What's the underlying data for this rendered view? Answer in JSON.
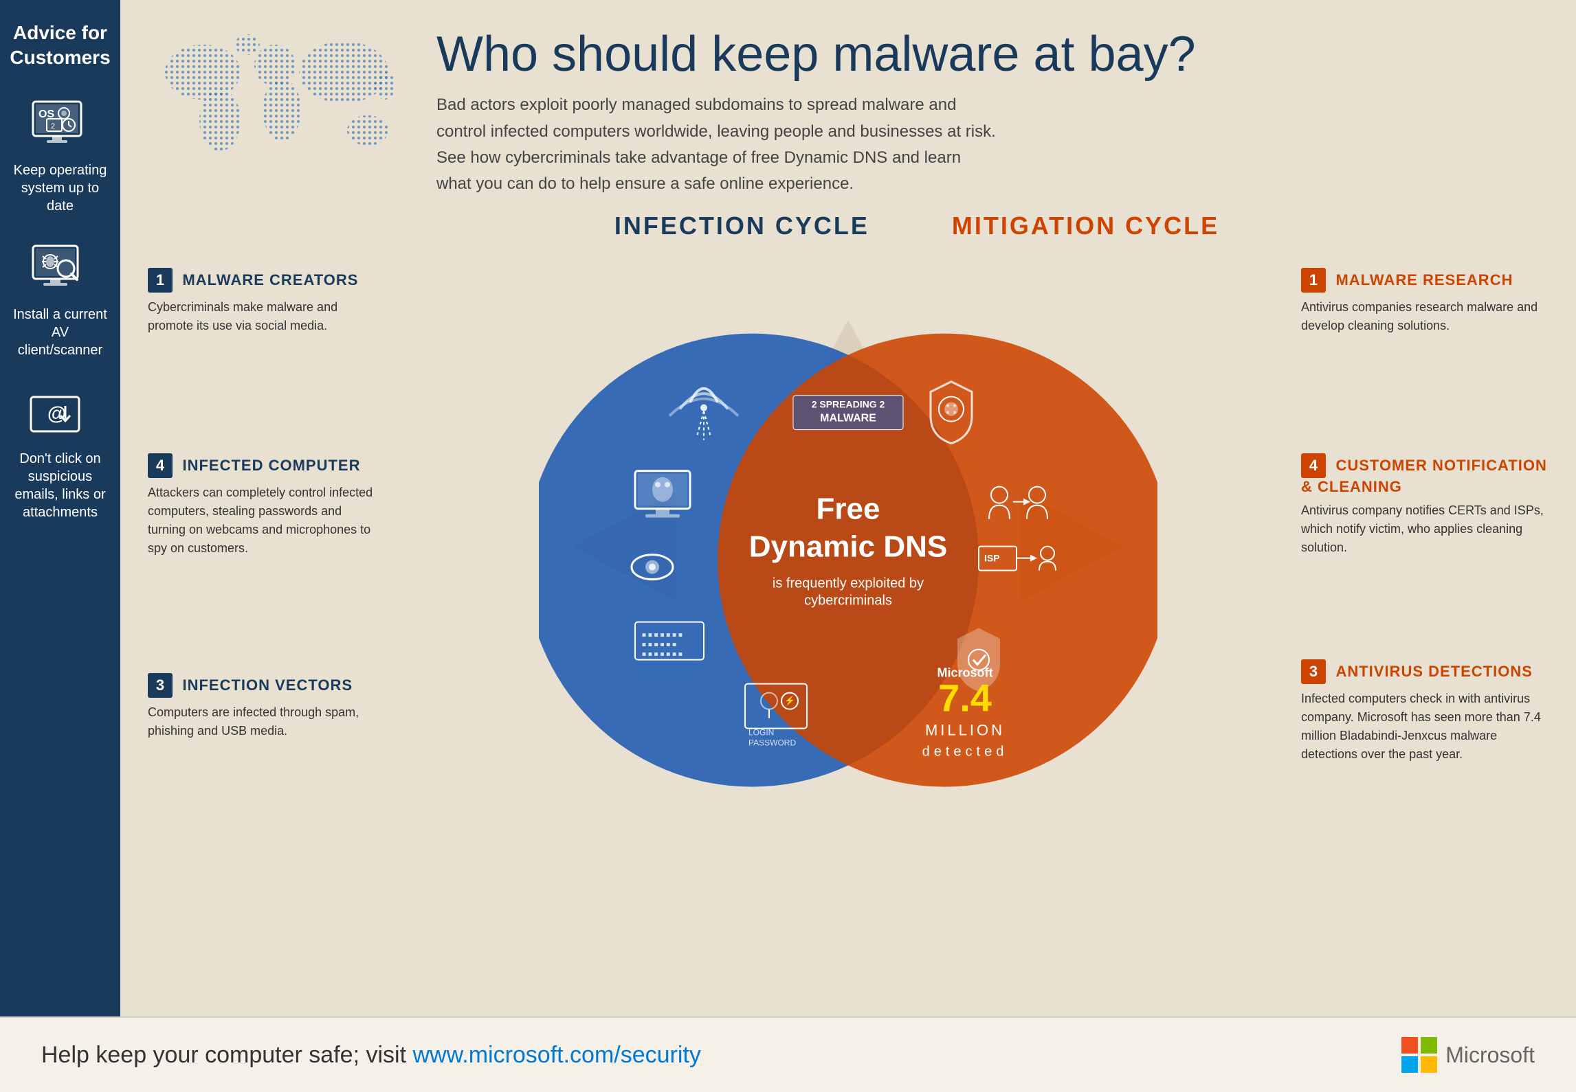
{
  "sidebar": {
    "title": "Advice for\nCustomers",
    "items": [
      {
        "label": "Keep operating\nsystem up to date",
        "icon": "os-icon"
      },
      {
        "label": "Install a current\nAV client/scanner",
        "icon": "av-icon"
      },
      {
        "label": "Don't click on\nsuspicious\nemails, links or\nattachments",
        "icon": "email-icon"
      }
    ]
  },
  "header": {
    "title": "Who should keep malware at bay?",
    "subtitle": "Bad actors exploit poorly managed subdomains to spread malware and control infected computers worldwide, leaving people and businesses at risk. See how cybercriminals take advantage of free Dynamic DNS and learn what you can do to help ensure a safe online experience."
  },
  "cycles": {
    "infection_label": "INFECTION CYCLE",
    "mitigation_label": "MITIGATION CYCLE"
  },
  "center": {
    "title": "Free\nDynamic DNS",
    "subtitle": "is frequently exploited by\ncybercriminals"
  },
  "spreading": {
    "number_left": "2",
    "number_right": "2",
    "label": "SPREADING\nMALWARE"
  },
  "microsoft_stat": {
    "brand": "Microsoft",
    "number": "7.4",
    "unit": "MILLION",
    "label": "detected"
  },
  "infection_boxes": [
    {
      "number": "1",
      "title": "MALWARE CREATORS",
      "text": "Cybercriminals make malware and promote its use via social media."
    },
    {
      "number": "4",
      "title": "INFECTED COMPUTER",
      "text": "Attackers can completely control infected computers, stealing passwords and turning on webcams and microphones to spy on customers."
    },
    {
      "number": "3",
      "title": "INFECTION VECTORS",
      "text": "Computers are infected through spam, phishing and USB media."
    }
  ],
  "mitigation_boxes": [
    {
      "number": "1",
      "title": "MALWARE RESEARCH",
      "text": "Antivirus companies research malware and develop cleaning solutions."
    },
    {
      "number": "4",
      "title": "CUSTOMER NOTIFICATION\n& CLEANING",
      "text": "Antivirus company notifies CERTs and ISPs, which notify victim, who applies cleaning solution."
    },
    {
      "number": "3",
      "title": "ANTIVIRUS DETECTIONS",
      "text": "Infected computers check in with antivirus company. Microsoft has seen more than 7.4 million Bladabindi-Jenxcus malware detections over the past year."
    }
  ],
  "footer": {
    "text": "Help keep your computer safe; visit ",
    "link": "www.microsoft.com/security",
    "ms_name": "Microsoft"
  },
  "colors": {
    "blue": "#1e5ab0",
    "orange": "#cc4400",
    "dark_blue": "#1a3a5c",
    "bg": "#e8e0d0"
  }
}
